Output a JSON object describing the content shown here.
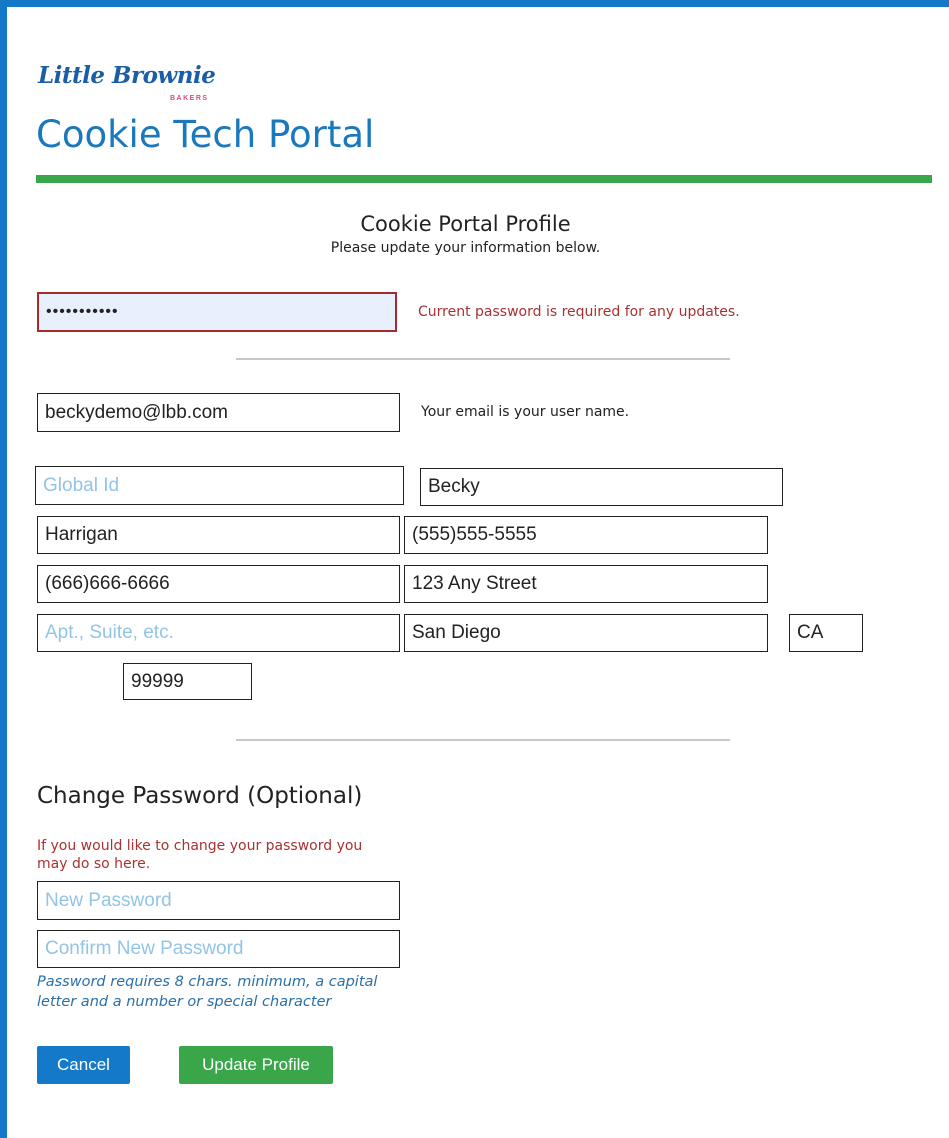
{
  "brand": {
    "logo_text": "Little Brownie",
    "logo_subtext": "BAKERS",
    "portal_title": "Cookie Tech Portal"
  },
  "profile": {
    "title": "Cookie Portal Profile",
    "subtitle": "Please update your information below."
  },
  "current_password": {
    "value": "•••••••••••",
    "error": "Current password is required for any updates."
  },
  "email": {
    "value": "beckydemo@lbb.com",
    "note": "Your email is your user name."
  },
  "fields": {
    "global_id_placeholder": "Global Id",
    "first_name": "Becky",
    "last_name": "Harrigan",
    "phone1": "(555)555-5555",
    "phone2": "(666)666-6666",
    "street": "123 Any Street",
    "apt_placeholder": "Apt., Suite, etc.",
    "city": "San Diego",
    "state": "CA",
    "zip": "99999"
  },
  "change_password": {
    "title": "Change Password (Optional)",
    "note": "If you would like to change your password you may do so here.",
    "new_placeholder": "New Password",
    "confirm_placeholder": "Confirm New Password",
    "hint": "Password requires 8 chars. minimum, a capital letter and a number or special character"
  },
  "buttons": {
    "cancel": "Cancel",
    "update": "Update Profile"
  },
  "colors": {
    "brand_blue": "#1479c9",
    "brand_green": "#3aa64a",
    "error_red": "#a83232",
    "placeholder_blue": "#92c4e8"
  }
}
